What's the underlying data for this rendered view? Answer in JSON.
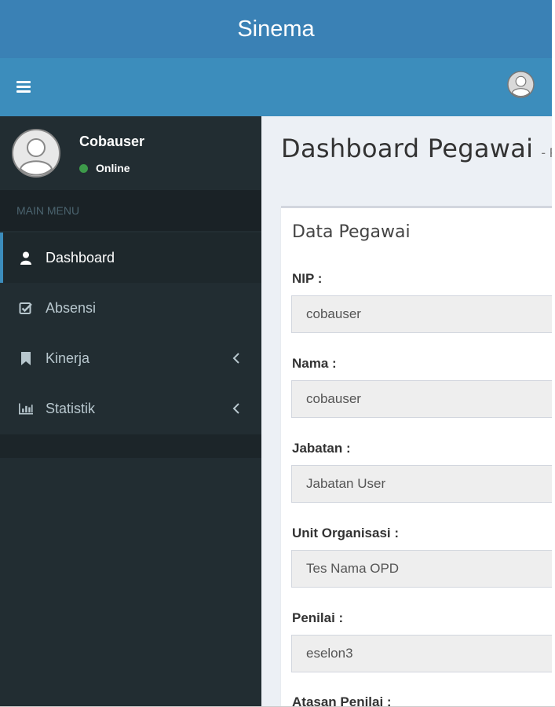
{
  "app": {
    "title": "Sinema"
  },
  "user": {
    "name": "Cobauser",
    "status": "Online"
  },
  "sidebar": {
    "menu_header": "MAIN MENU",
    "items": [
      {
        "label": "Dashboard",
        "icon": "user-icon",
        "active": true
      },
      {
        "label": "Absensi",
        "icon": "check-square-icon",
        "active": false
      },
      {
        "label": "Kinerja",
        "icon": "bookmark-icon",
        "active": false,
        "has_submenu": true
      },
      {
        "label": "Statistik",
        "icon": "bar-chart-icon",
        "active": false,
        "has_submenu": true
      }
    ]
  },
  "page": {
    "title": "Dashboard Pegawai",
    "subtitle": "- Prof"
  },
  "box": {
    "title": "Data Pegawai",
    "fields": [
      {
        "label": "NIP :",
        "value": "cobauser"
      },
      {
        "label": "Nama :",
        "value": "cobauser"
      },
      {
        "label": "Jabatan :",
        "value": "Jabatan User"
      },
      {
        "label": "Unit Organisasi :",
        "value": "Tes Nama OPD"
      },
      {
        "label": "Penilai :",
        "value": "eselon3"
      },
      {
        "label": "Atasan Penilai :"
      }
    ]
  },
  "colors": {
    "header": "#3a81b5",
    "navbar": "#3c8dbc",
    "sidebar": "#222d32",
    "content_bg": "#ecf0f5",
    "status_online": "#3d9a4a"
  }
}
